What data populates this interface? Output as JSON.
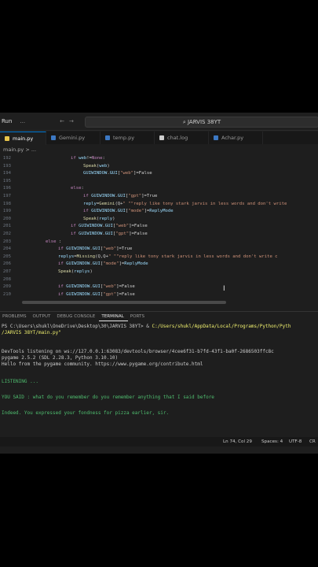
{
  "titlebar": {
    "menu": "Run",
    "dots": "...",
    "search": "JARVIS 38YT"
  },
  "tabs": [
    {
      "label": "main.py",
      "active": true,
      "color": "#e8c54b"
    },
    {
      "label": "Gemini.py",
      "active": false,
      "color": "#3c78c3"
    },
    {
      "label": "temp.py",
      "active": false,
      "color": "#3c78c3"
    },
    {
      "label": "chat.log",
      "active": false,
      "color": "#cccccc"
    },
    {
      "label": "Achar.py",
      "active": false,
      "color": "#3c78c3"
    }
  ],
  "breadcrumb": "main.py > ...",
  "code_lines": [
    {
      "n": "192",
      "indent": 90,
      "parts": [
        [
          "kw",
          "if "
        ],
        [
          "var",
          "web"
        ],
        [
          "op",
          "!="
        ],
        [
          "kw",
          "None"
        ],
        [
          "op",
          ":"
        ]
      ]
    },
    {
      "n": "193",
      "indent": 106,
      "parts": [
        [
          "fn",
          "Speak"
        ],
        [
          "op",
          "("
        ],
        [
          "var",
          "web"
        ],
        [
          "op",
          ")"
        ]
      ]
    },
    {
      "n": "194",
      "indent": 106,
      "parts": [
        [
          "var",
          "GUIWINDOW"
        ],
        [
          "op",
          "."
        ],
        [
          "var",
          "GUI"
        ],
        [
          "op",
          "["
        ],
        [
          "str",
          "\"web\""
        ],
        [
          "op",
          "]=False"
        ]
      ]
    },
    {
      "n": "195",
      "indent": 90,
      "parts": [
        [
          "op",
          ""
        ]
      ]
    },
    {
      "n": "196",
      "indent": 90,
      "parts": [
        [
          "kw",
          "else"
        ],
        [
          "op",
          ":"
        ]
      ]
    },
    {
      "n": "197",
      "indent": 106,
      "parts": [
        [
          "kw",
          "if "
        ],
        [
          "var",
          "GUIWINDOW"
        ],
        [
          "op",
          "."
        ],
        [
          "var",
          "GUI"
        ],
        [
          "op",
          "["
        ],
        [
          "str",
          "\"gpt\""
        ],
        [
          "op",
          "]=True"
        ]
      ]
    },
    {
      "n": "198",
      "indent": 106,
      "parts": [
        [
          "var",
          "reply"
        ],
        [
          "op",
          "="
        ],
        [
          "fn",
          "Gemini"
        ],
        [
          "op",
          "(Q+"
        ],
        [
          "str",
          "\" \"\"reply like tony stark jarvis in less words and don't write"
        ]
      ]
    },
    {
      "n": "199",
      "indent": 106,
      "parts": [
        [
          "kw",
          "if "
        ],
        [
          "var",
          "GUIWINDOW"
        ],
        [
          "op",
          "."
        ],
        [
          "var",
          "GUI"
        ],
        [
          "op",
          "["
        ],
        [
          "str",
          "\"mode\""
        ],
        [
          "op",
          "]="
        ],
        [
          "var",
          "ReplyMode"
        ]
      ]
    },
    {
      "n": "200",
      "indent": 106,
      "parts": [
        [
          "fn",
          "Speak"
        ],
        [
          "op",
          "("
        ],
        [
          "var",
          "reply"
        ],
        [
          "op",
          ")"
        ]
      ]
    },
    {
      "n": "201",
      "indent": 90,
      "parts": [
        [
          "kw",
          "if "
        ],
        [
          "var",
          "GUIWINDOW"
        ],
        [
          "op",
          "."
        ],
        [
          "var",
          "GUI"
        ],
        [
          "op",
          "["
        ],
        [
          "str",
          "\"web\""
        ],
        [
          "op",
          "]=False"
        ]
      ]
    },
    {
      "n": "202",
      "indent": 90,
      "parts": [
        [
          "kw",
          "if "
        ],
        [
          "var",
          "GUIWINDOW"
        ],
        [
          "op",
          "."
        ],
        [
          "var",
          "GUI"
        ],
        [
          "op",
          "["
        ],
        [
          "str",
          "\"gpt\""
        ],
        [
          "op",
          "]=False"
        ]
      ]
    },
    {
      "n": "203",
      "indent": 58,
      "parts": [
        [
          "kw",
          "else"
        ],
        [
          "op",
          " :"
        ]
      ]
    },
    {
      "n": "204",
      "indent": 74,
      "parts": [
        [
          "kw",
          "if "
        ],
        [
          "var",
          "GUIWINDOW"
        ],
        [
          "op",
          "."
        ],
        [
          "var",
          "GUI"
        ],
        [
          "op",
          "["
        ],
        [
          "str",
          "\"web\""
        ],
        [
          "op",
          "]=True"
        ]
      ]
    },
    {
      "n": "205",
      "indent": 74,
      "parts": [
        [
          "var",
          "replys"
        ],
        [
          "op",
          "="
        ],
        [
          "fn",
          "Missing"
        ],
        [
          "op",
          "(Q,Q+"
        ],
        [
          "str",
          "\" \"\"reply like tony stark jarvis in less words and don't write c"
        ]
      ]
    },
    {
      "n": "206",
      "indent": 74,
      "parts": [
        [
          "kw",
          "if "
        ],
        [
          "var",
          "GUIWINDOW"
        ],
        [
          "op",
          "."
        ],
        [
          "var",
          "GUI"
        ],
        [
          "op",
          "["
        ],
        [
          "str",
          "\"mode\""
        ],
        [
          "op",
          "]="
        ],
        [
          "var",
          "ReplyMode"
        ]
      ]
    },
    {
      "n": "207",
      "indent": 74,
      "parts": [
        [
          "fn",
          "Speak"
        ],
        [
          "op",
          "("
        ],
        [
          "var",
          "replys"
        ],
        [
          "op",
          ")"
        ]
      ]
    },
    {
      "n": "208",
      "indent": 74,
      "parts": [
        [
          "op",
          ""
        ]
      ]
    },
    {
      "n": "209",
      "indent": 74,
      "parts": [
        [
          "kw",
          "if "
        ],
        [
          "var",
          "GUIWINDOW"
        ],
        [
          "op",
          "."
        ],
        [
          "var",
          "GUI"
        ],
        [
          "op",
          "["
        ],
        [
          "str",
          "\"web\""
        ],
        [
          "op",
          "]=False"
        ]
      ]
    },
    {
      "n": "210",
      "indent": 74,
      "parts": [
        [
          "kw",
          "if "
        ],
        [
          "var",
          "GUIWINDOW"
        ],
        [
          "op",
          "."
        ],
        [
          "var",
          "GUI"
        ],
        [
          "op",
          "["
        ],
        [
          "str",
          "\"gpt\""
        ],
        [
          "op",
          "]=False"
        ]
      ]
    }
  ],
  "panel_tabs": [
    "PROBLEMS",
    "OUTPUT",
    "DEBUG CONSOLE",
    "TERMINAL",
    "PORTS"
  ],
  "active_panel_tab": "TERMINAL",
  "terminal": {
    "prompt": "PS C:\\Users\\shukl\\OneDrive\\Desktop\\30\\JARVIS 38YT> & ",
    "python_path": "C:/Users/shukl/AppData/Local/Programs/Python/Pyth",
    "script_path": "/JARVIS 38YT/main.py\"",
    "devtools": "DevTools listening on ws://127.0.0.1:63083/devtools/browser/4cee6f31-b7fd-43f1-ba0f-2686503ffc8c",
    "pygame": "pygame 2.5.2 (SDL 2.28.3, Python 3.10.10)",
    "hello": "Hello from the pygame community. https://www.pygame.org/contribute.html",
    "listening": "LISTENING ...",
    "you_said": "YOU SAID : what do you remember do you remember anything that I said before",
    "reply": "Indeed. You expressed your fondness for pizza earlier, sir."
  },
  "statusbar": {
    "position": "Ln 74, Col 29",
    "spaces": "Spaces: 4",
    "encoding": "UTF-8",
    "eol": "CR"
  },
  "taskbar_colors": [
    "#d9d9d9",
    "#6ea8d8",
    "#f0c24b",
    "#2f8de4",
    "#4aa3df",
    "#7b68ee",
    "#cccccc",
    "#9a9a9a",
    "#3c78c3"
  ]
}
